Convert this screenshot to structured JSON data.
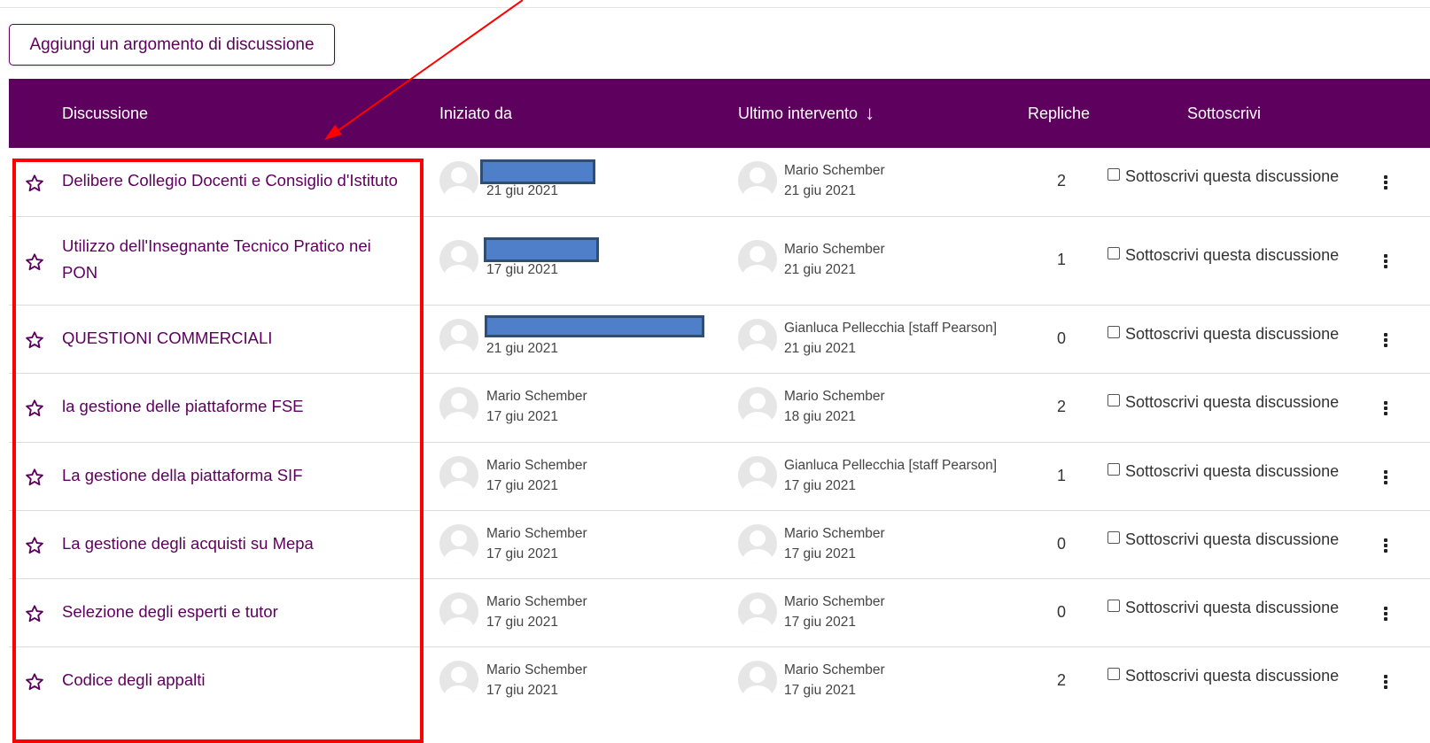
{
  "add_button_label": "Aggiungi un argomento di discussione",
  "header": {
    "discussion": "Discussione",
    "started_by": "Iniziato da",
    "last_post": "Ultimo intervento",
    "replies": "Repliche",
    "subscribe": "Sottoscrivi"
  },
  "rows": [
    {
      "title": "Delibere Collegio Docenti e Consiglio d'Istituto",
      "started_name": "",
      "started_date": "21 giu 2021",
      "last_name": "Mario Schember",
      "last_date": "21 giu 2021",
      "replies": "2",
      "subscribe": "Sottoscrivi questa discussione"
    },
    {
      "title": "Utilizzo dell'Insegnante Tecnico Pratico nei PON",
      "started_name": "",
      "started_date": "17 giu 2021",
      "last_name": "Mario Schember",
      "last_date": "21 giu 2021",
      "replies": "1",
      "subscribe": "Sottoscrivi questa discussione"
    },
    {
      "title": "QUESTIONI COMMERCIALI",
      "started_name": "",
      "started_date": "21 giu 2021",
      "last_name": "Gianluca Pellecchia [staff Pearson]",
      "last_date": "21 giu 2021",
      "replies": "0",
      "subscribe": "Sottoscrivi questa discussione"
    },
    {
      "title": "la gestione delle piattaforme FSE",
      "started_name": "Mario Schember",
      "started_date": "17 giu 2021",
      "last_name": "Mario Schember",
      "last_date": "18 giu 2021",
      "replies": "2",
      "subscribe": "Sottoscrivi questa discussione"
    },
    {
      "title": "La gestione della piattaforma SIF",
      "started_name": "Mario Schember",
      "started_date": "17 giu 2021",
      "last_name": "Gianluca Pellecchia [staff Pearson]",
      "last_date": "17 giu 2021",
      "replies": "1",
      "subscribe": "Sottoscrivi questa discussione"
    },
    {
      "title": "La gestione degli acquisti su Mepa",
      "started_name": "Mario Schember",
      "started_date": "17 giu 2021",
      "last_name": "Mario Schember",
      "last_date": "17 giu 2021",
      "replies": "0",
      "subscribe": "Sottoscrivi questa discussione"
    },
    {
      "title": "Selezione degli esperti e tutor",
      "started_name": "Mario Schember",
      "started_date": "17 giu 2021",
      "last_name": "Mario Schember",
      "last_date": "17 giu 2021",
      "replies": "0",
      "subscribe": "Sottoscrivi questa discussione"
    },
    {
      "title": "Codice degli appalti",
      "started_name": "Mario Schember",
      "started_date": "17 giu 2021",
      "last_name": "Mario Schember",
      "last_date": "17 giu 2021",
      "replies": "2",
      "subscribe": "Sottoscrivi questa discussione"
    }
  ],
  "colors": {
    "brand": "#5e005e",
    "annotation": "#ff0000",
    "redaction": "#4f7fc8"
  }
}
